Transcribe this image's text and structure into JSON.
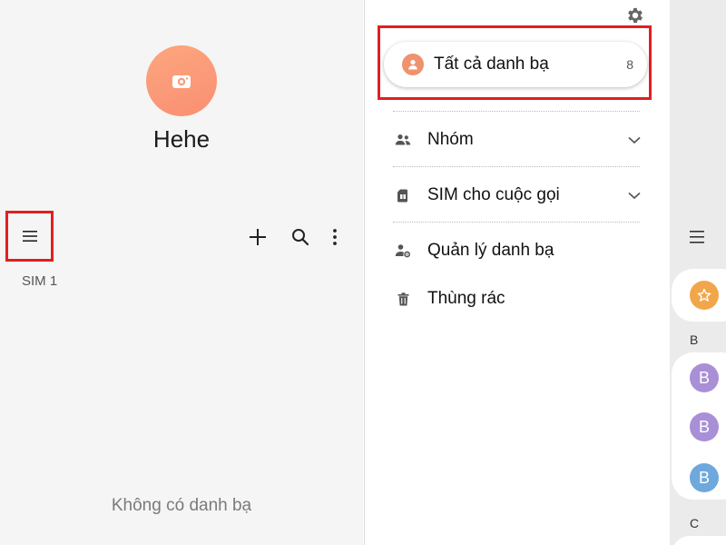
{
  "profile": {
    "name": "Hehe",
    "avatar_color": "#fa9b76"
  },
  "toolbar": {
    "menu_icon": "hamburger-icon",
    "add_icon": "plus-icon",
    "search_icon": "search-icon",
    "more_icon": "more-vert-icon"
  },
  "account": {
    "label": "SIM 1"
  },
  "contacts_list": {
    "empty_message": "Không có danh bạ"
  },
  "drawer": {
    "settings_icon": "gear-icon",
    "all_contacts": {
      "label": "Tất cả danh bạ",
      "count": "8",
      "icon": "person-icon",
      "icon_color": "#f0926e"
    },
    "items": [
      {
        "label": "Nhóm",
        "icon": "group-icon",
        "expandable": true
      },
      {
        "label": "SIM cho cuộc gọi",
        "icon": "sim-card-icon",
        "expandable": true
      },
      {
        "label": "Quản lý danh bạ",
        "icon": "manage-contacts-icon",
        "expandable": false
      },
      {
        "label": "Thùng rác",
        "icon": "trash-icon",
        "expandable": false
      }
    ]
  },
  "background_list": {
    "sections": [
      {
        "letter": "B"
      },
      {
        "letter": "C"
      }
    ],
    "avatars": [
      {
        "letter": "B",
        "color": "#a98fd6"
      },
      {
        "letter": "B",
        "color": "#a98fd6"
      },
      {
        "letter": "B",
        "color": "#6fa8dc"
      }
    ],
    "favorites_icon": "star-icon",
    "favorites_color": "#f2a64a"
  },
  "colors": {
    "highlight": "#e02020",
    "left_bg": "#f5f5f5",
    "drawer_bg": "#ffffff"
  }
}
